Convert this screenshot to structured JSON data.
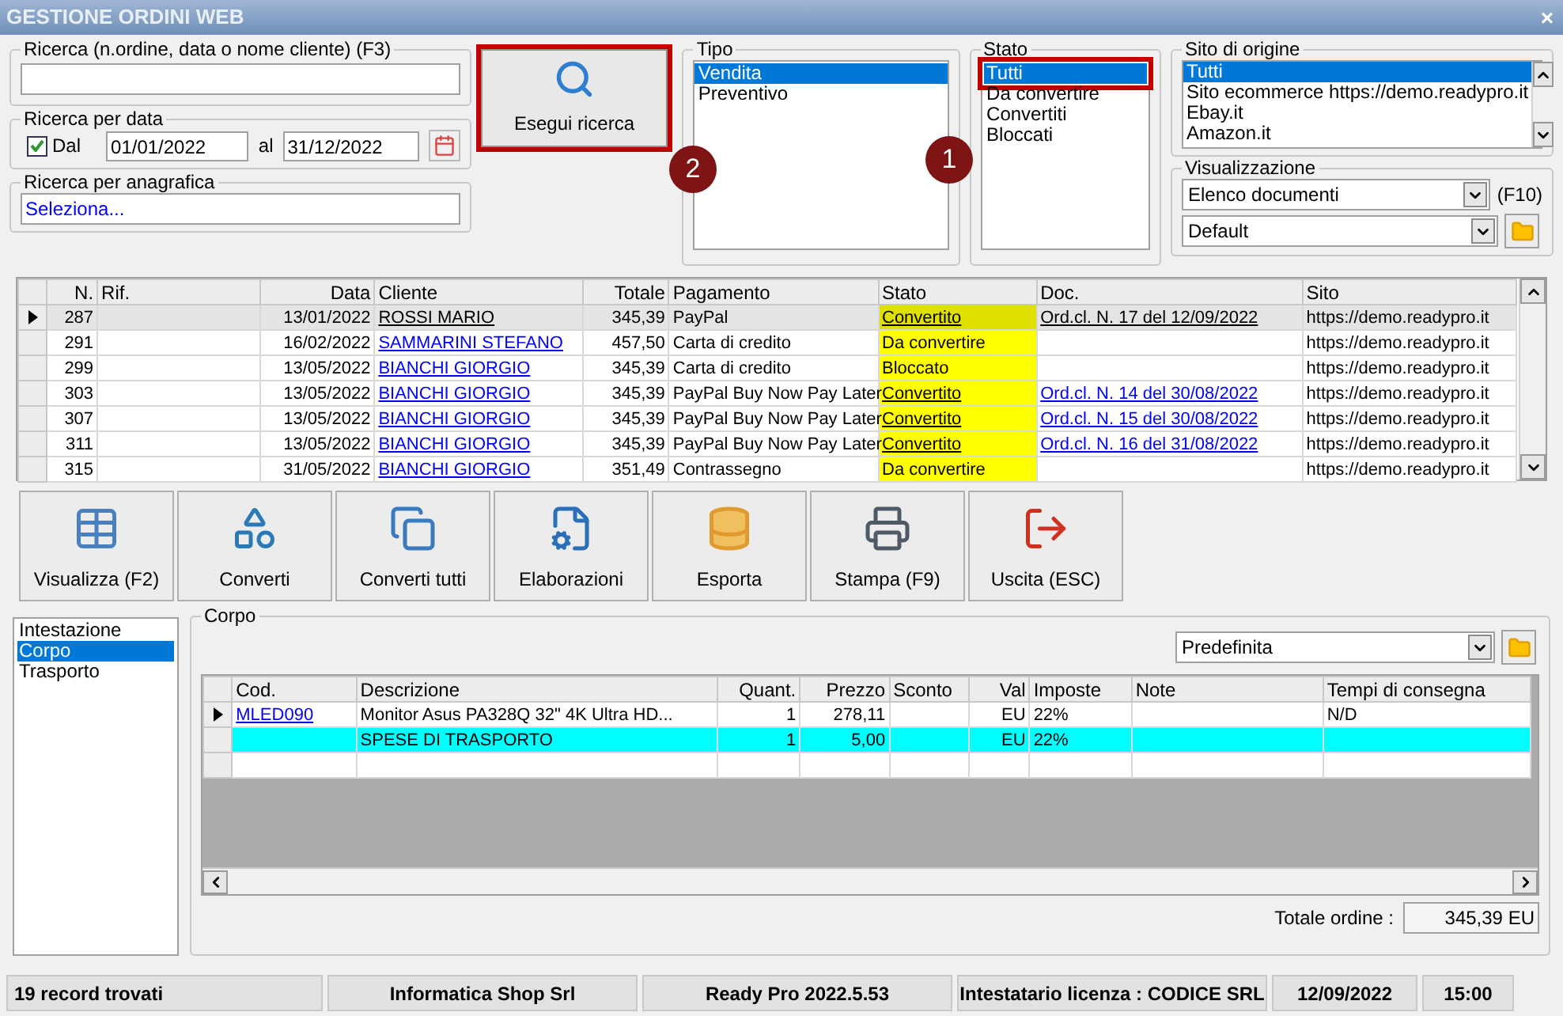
{
  "window": {
    "title": "GESTIONE ORDINI WEB",
    "close": "×"
  },
  "search": {
    "label": "Ricerca (n.ordine, data o nome cliente) (F3)"
  },
  "date_search": {
    "label": "Ricerca per data",
    "checkbox_label": "Dal",
    "checked": true,
    "from": "01/01/2022",
    "to_label": "al",
    "to": "31/12/2022"
  },
  "registry_search": {
    "label": "Ricerca per anagrafica",
    "value": "Seleziona..."
  },
  "search_button": {
    "label": "Esegui ricerca",
    "annotated": true
  },
  "tipo": {
    "label": "Tipo",
    "items": [
      {
        "label": "Vendita",
        "selected": true,
        "annotated": false
      },
      {
        "label": "Preventivo",
        "selected": false,
        "annotated": false
      }
    ]
  },
  "stato": {
    "label": "Stato",
    "items": [
      {
        "label": "Tutti",
        "selected": true,
        "annotated": true
      },
      {
        "label": "Da convertire",
        "selected": false,
        "annotated": false
      },
      {
        "label": "Convertiti",
        "selected": false,
        "annotated": false
      },
      {
        "label": "Bloccati",
        "selected": false,
        "annotated": false
      }
    ]
  },
  "sito": {
    "label": "Sito di origine",
    "items": [
      {
        "label": "Tutti",
        "selected": true
      },
      {
        "label": "Sito ecommerce https://demo.readypro.it",
        "selected": false
      },
      {
        "label": "Ebay.it",
        "selected": false
      },
      {
        "label": "Amazon.it",
        "selected": false
      }
    ]
  },
  "visualizzazione": {
    "label": "Visualizzazione",
    "view": "Elenco documenti",
    "shortcut": "(F10)",
    "layout": "Default"
  },
  "callouts": [
    "1",
    "2"
  ],
  "orders": {
    "columns": [
      "N.",
      "Rif.",
      "Data",
      "Cliente",
      "Totale",
      "Pagamento",
      "Stato",
      "Doc.",
      "Sito"
    ],
    "rows": [
      {
        "current": true,
        "n": "287",
        "data": "13/01/2022",
        "cliente": "ROSSI MARIO",
        "totale": "345,39",
        "pagamento": "PayPal",
        "stato": "Convertito",
        "stato_link": true,
        "doc": "Ord.cl. N. 17 del 12/09/2022",
        "sito": "https://demo.readypro.it"
      },
      {
        "current": false,
        "n": "291",
        "data": "16/02/2022",
        "cliente": "SAMMARINI STEFANO",
        "totale": "457,50",
        "pagamento": "Carta di credito",
        "stato": "Da convertire",
        "stato_link": false,
        "sito": "https://demo.readypro.it"
      },
      {
        "current": false,
        "n": "299",
        "data": "13/05/2022",
        "cliente": "BIANCHI GIORGIO",
        "totale": "345,39",
        "pagamento": "Carta di credito",
        "stato": "Bloccato",
        "stato_link": false,
        "sito": "https://demo.readypro.it"
      },
      {
        "current": false,
        "n": "303",
        "data": "13/05/2022",
        "cliente": "BIANCHI GIORGIO",
        "totale": "345,39",
        "pagamento": "PayPal Buy Now Pay Later",
        "stato": "Convertito",
        "stato_link": true,
        "doc": "Ord.cl. N. 14 del 30/08/2022",
        "sito": "https://demo.readypro.it"
      },
      {
        "current": false,
        "n": "307",
        "data": "13/05/2022",
        "cliente": "BIANCHI GIORGIO",
        "totale": "345,39",
        "pagamento": "PayPal Buy Now Pay Later",
        "stato": "Convertito",
        "stato_link": true,
        "doc": "Ord.cl. N. 15 del 30/08/2022",
        "sito": "https://demo.readypro.it"
      },
      {
        "current": false,
        "n": "311",
        "data": "13/05/2022",
        "cliente": "BIANCHI GIORGIO",
        "totale": "345,39",
        "pagamento": "PayPal Buy Now Pay Later",
        "stato": "Convertito",
        "stato_link": true,
        "doc": "Ord.cl. N. 16 del 31/08/2022",
        "sito": "https://demo.readypro.it"
      },
      {
        "current": false,
        "n": "315",
        "data": "31/05/2022",
        "cliente": "BIANCHI GIORGIO",
        "totale": "351,49",
        "pagamento": "Contrassegno",
        "stato": "Da convertire",
        "stato_link": false,
        "sito": "https://demo.readypro.it"
      }
    ]
  },
  "toolbar": [
    "Visualizza (F2)",
    "Converti",
    "Converti tutti",
    "Elaborazioni",
    "Esporta",
    "Stampa (F9)",
    "Uscita (ESC)"
  ],
  "sections": [
    {
      "label": "Intestazione",
      "selected": false
    },
    {
      "label": "Corpo",
      "selected": true
    },
    {
      "label": "Trasporto",
      "selected": false
    }
  ],
  "corpo": {
    "label": "Corpo",
    "layout": "Predefinita",
    "columns": [
      "Cod.",
      "Descrizione",
      "Quant.",
      "Prezzo",
      "Sconto",
      "Val",
      "Imposte",
      "Note",
      "Tempi di consegna"
    ],
    "rows": [
      {
        "current": true,
        "highlighted": false,
        "cod": "MLED090",
        "descrizione": "Monitor Asus PA328Q 32\" 4K Ultra HD...",
        "quant": "1",
        "prezzo": "278,11",
        "val": "EU",
        "imposte": "22%",
        "tempi": "N/D"
      },
      {
        "current": false,
        "highlighted": true,
        "descrizione": "SPESE DI TRASPORTO",
        "quant": "1",
        "prezzo": "5,00",
        "val": "EU",
        "imposte": "22%"
      }
    ],
    "total_label": "Totale ordine :",
    "total": "345,39 EU"
  },
  "status_bar": [
    "19 record trovati",
    "Informatica Shop Srl",
    "Ready Pro 2022.5.53",
    "Intestatario licenza : CODICE SRL",
    "12/09/2022",
    "15:00"
  ]
}
